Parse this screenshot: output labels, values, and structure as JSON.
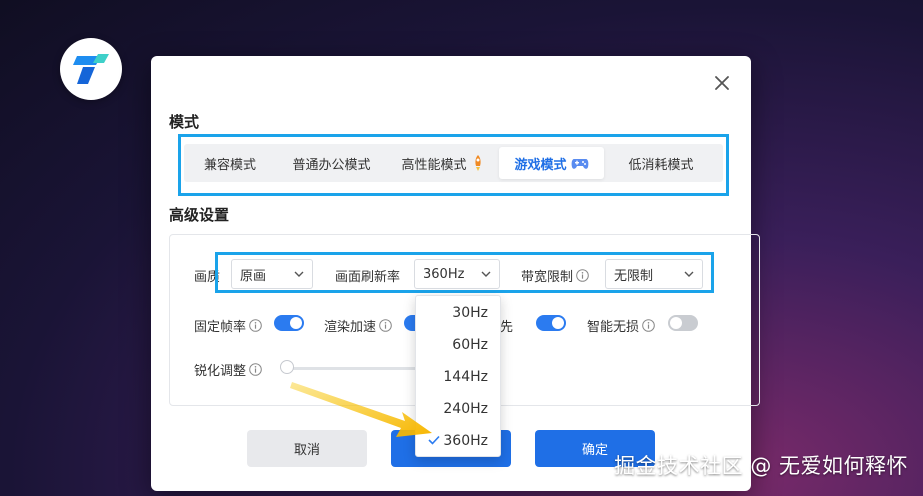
{
  "modes": {
    "section_title": "模式",
    "tabs": [
      {
        "label": "兼容模式",
        "icon": ""
      },
      {
        "label": "普通办公模式",
        "icon": ""
      },
      {
        "label": "高性能模式",
        "icon": "rocket-icon"
      },
      {
        "label": "游戏模式",
        "icon": "gamepad-icon"
      },
      {
        "label": "低消耗模式",
        "icon": ""
      }
    ],
    "active_index": 3
  },
  "advanced": {
    "section_title": "高级设置",
    "quality": {
      "label": "画质",
      "value": "原画"
    },
    "refresh": {
      "label": "画面刷新率",
      "value": "360Hz"
    },
    "bandwidth": {
      "label": "带宽限制",
      "value": "无限制"
    },
    "toggles": [
      {
        "label": "固定帧率",
        "on": true
      },
      {
        "label": "渲染加速",
        "on": true
      },
      {
        "label": "先",
        "on": true
      },
      {
        "label": "智能无损",
        "on": false
      }
    ],
    "sharpen": {
      "label": "锐化调整",
      "value": 0
    }
  },
  "dropdown": {
    "options": [
      "30Hz",
      "60Hz",
      "144Hz",
      "240Hz",
      "360Hz"
    ],
    "selected": "360Hz"
  },
  "buttons": {
    "cancel": "取消",
    "ok": "确定"
  },
  "watermark": "掘金技术社区 @ 无爱如何释怀",
  "colors": {
    "accent": "#1f6fe6",
    "highlight_box": "#1aa3ea",
    "arrow": "#f5b800"
  }
}
